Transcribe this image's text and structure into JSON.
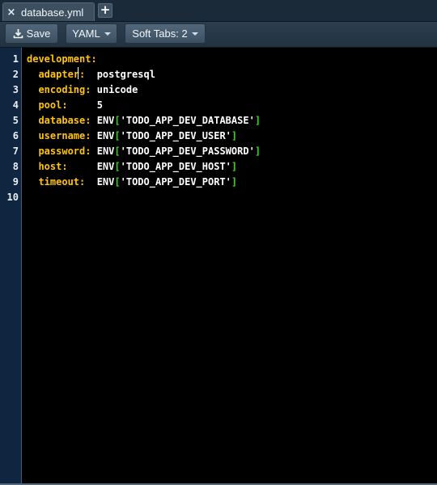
{
  "tabbar": {
    "tabs": [
      {
        "close": "×",
        "label": "database.yml"
      }
    ],
    "new_tab": "+"
  },
  "toolbar": {
    "save_label": "Save",
    "language": "YAML",
    "indent": "Soft Tabs: 2"
  },
  "editor": {
    "line_numbers": [
      "1",
      "2",
      "3",
      "4",
      "5",
      "6",
      "7",
      "8",
      "9",
      "10"
    ],
    "lines": [
      {
        "key": "development:",
        "value": "",
        "env": false
      },
      {
        "key": "  adapter:",
        "value": "postgresql",
        "env": false
      },
      {
        "key": "  encoding:",
        "value": "unicode",
        "env": false
      },
      {
        "key": "  pool:",
        "value": "5",
        "env": false
      },
      {
        "key": "  database:",
        "value": "ENV",
        "env": true,
        "str": "'TODO_APP_DEV_DATABASE'"
      },
      {
        "key": "  username:",
        "value": "ENV",
        "env": true,
        "str": "'TODO_APP_DEV_USER'"
      },
      {
        "key": "  password:",
        "value": "ENV",
        "env": true,
        "str": "'TODO_APP_DEV_PASSWORD'"
      },
      {
        "key": "  host:",
        "value": "ENV",
        "env": true,
        "str": "'TODO_APP_DEV_HOST'"
      },
      {
        "key": "  timeout:",
        "value": "ENV",
        "env": true,
        "str": "'TODO_APP_DEV_PORT'"
      },
      {
        "key": "",
        "value": "",
        "env": false
      }
    ]
  },
  "colors": {
    "key": "#ffc20e",
    "bracket": "#32d919",
    "gutter": "#0f2540"
  }
}
